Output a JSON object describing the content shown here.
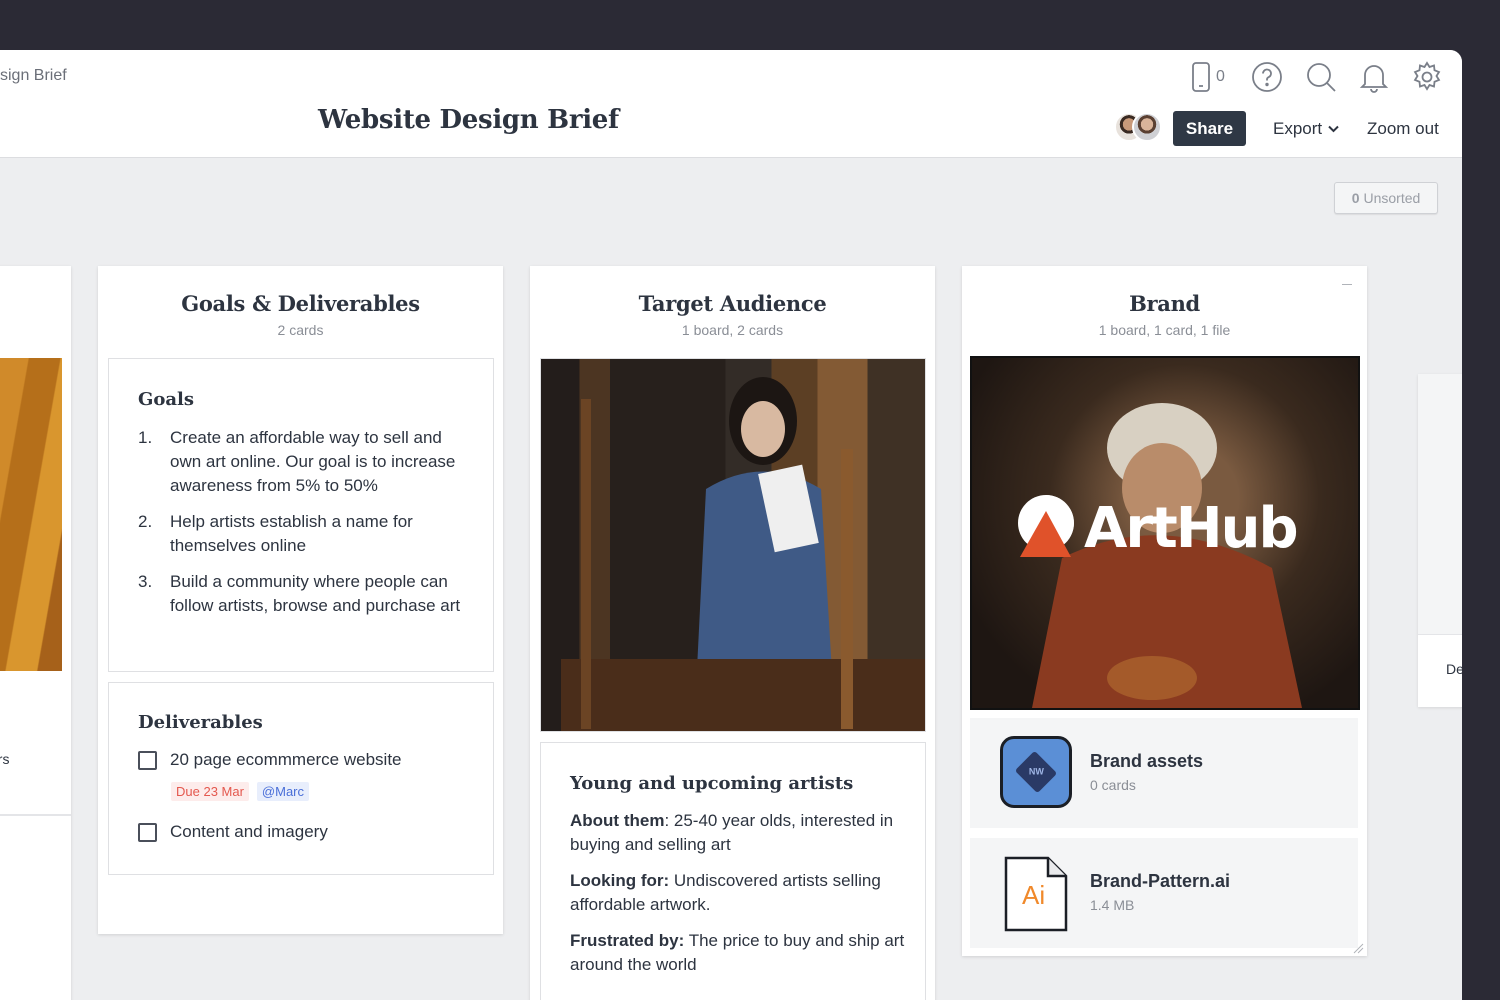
{
  "breadcrumb": "sign Brief",
  "board_title": "Website Design Brief",
  "toolbar": {
    "device_count": "0",
    "share_label": "Share",
    "export_label": "Export",
    "zoom_label": "Zoom out"
  },
  "unsorted": {
    "count": "0",
    "label": "Unsorted"
  },
  "left_column": {
    "partial_text": "ers"
  },
  "goals_column": {
    "title": "Goals & Deliverables",
    "subtitle": "2 cards",
    "goals_card": {
      "heading": "Goals",
      "items": [
        {
          "num": "1.",
          "text": "Create an affordable way to sell and own art online. Our goal is to increase awareness from 5% to 50%"
        },
        {
          "num": "2.",
          "text": "Help artists establish a name for themselves online"
        },
        {
          "num": "3.",
          "text": "Build a community where people can follow artists, browse and purchase art"
        }
      ]
    },
    "deliverables_card": {
      "heading": "Deliverables",
      "tasks": [
        {
          "label": "20 page ecommmerce website",
          "due": "Due 23 Mar",
          "assignee": "@Marc"
        },
        {
          "label": "Content and imagery"
        }
      ]
    }
  },
  "audience_column": {
    "title": "Target Audience",
    "subtitle": "1 board, 2 cards",
    "card": {
      "heading": "Young and upcoming artists",
      "about_label": "About them",
      "about_text": ": 25-40 year olds, interested in buying and selling art",
      "looking_label": "Looking for:",
      "looking_text": " Undiscovered artists selling affordable artwork.",
      "frustrated_label": "Frustrated by:",
      "frustrated_text": " The price to buy and ship art around the world"
    }
  },
  "brand_column": {
    "title": "Brand",
    "subtitle": "1 board, 1 card, 1 file",
    "logo_text": "ArtHub",
    "board_link": {
      "name": "Brand assets",
      "meta": "0 cards",
      "icon_text": "NW"
    },
    "file": {
      "name": "Brand-Pattern.ai",
      "meta": "1.4 MB",
      "icon_text": "Ai"
    }
  },
  "right_partial": {
    "text": "De"
  },
  "colors": {
    "share_bg": "#2f3845",
    "accent_blue": "#5b8fd6",
    "ai_orange": "#f0892b",
    "logo_red": "#e0522a"
  }
}
